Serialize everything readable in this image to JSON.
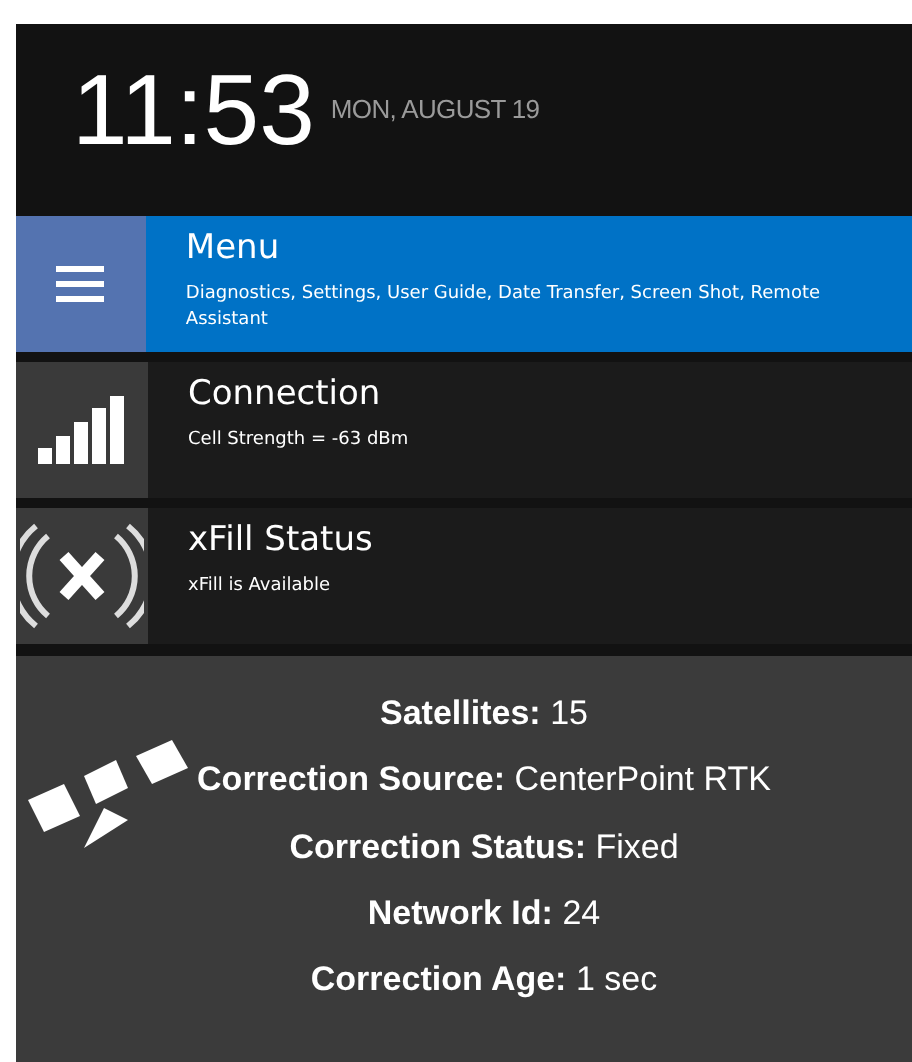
{
  "clock": {
    "time": "11:53",
    "date": "MON, AUGUST 19"
  },
  "items": [
    {
      "kind": "menu",
      "title": "Menu",
      "subtitle": "Diagnostics, Settings, User Guide, Date Transfer, Screen Shot, Remote Assistant",
      "selected": true
    },
    {
      "kind": "signal",
      "title": "Connection",
      "subtitle": "Cell Strength = -63 dBm",
      "selected": false
    },
    {
      "kind": "xfill",
      "title": "xFill Status",
      "subtitle": "xFill is Available",
      "selected": false
    }
  ],
  "status": [
    {
      "label": "Satellites:",
      "value": "15"
    },
    {
      "label": "Correction Source:",
      "value": "CenterPoint RTK"
    },
    {
      "label": "Correction Status:",
      "value": "Fixed"
    },
    {
      "label": "Network Id:",
      "value": "24"
    },
    {
      "label": "Correction Age:",
      "value": "1 sec"
    }
  ]
}
